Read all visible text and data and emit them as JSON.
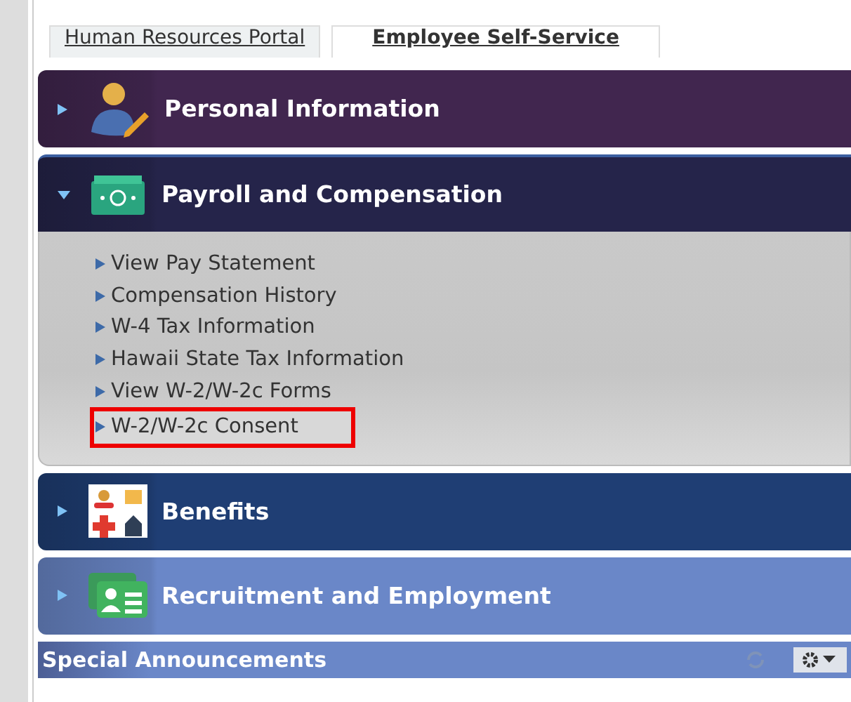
{
  "tabs": [
    {
      "label": "Human Resources Portal",
      "selected": false
    },
    {
      "label": "Employee Self-Service",
      "selected": true
    }
  ],
  "sections": [
    {
      "title": "Personal Information",
      "expanded": false,
      "color": "#41264f"
    },
    {
      "title": "Payroll and Compensation",
      "expanded": true,
      "color": "#25244a",
      "links": [
        {
          "label": "View Pay Statement",
          "highlighted": false
        },
        {
          "label": "Compensation History",
          "highlighted": false
        },
        {
          "label": "W-4 Tax Information",
          "highlighted": false
        },
        {
          "label": "Hawaii State Tax Information",
          "highlighted": false
        },
        {
          "label": "View W-2/W-2c Forms",
          "highlighted": false
        },
        {
          "label": "W-2/W-2c Consent",
          "highlighted": true
        }
      ]
    },
    {
      "title": "Benefits",
      "expanded": false,
      "color": "#1f3e74"
    },
    {
      "title": "Recruitment and Employment",
      "expanded": false,
      "color": "#6a87c8"
    }
  ],
  "announcements": {
    "title": "Special Announcements"
  }
}
